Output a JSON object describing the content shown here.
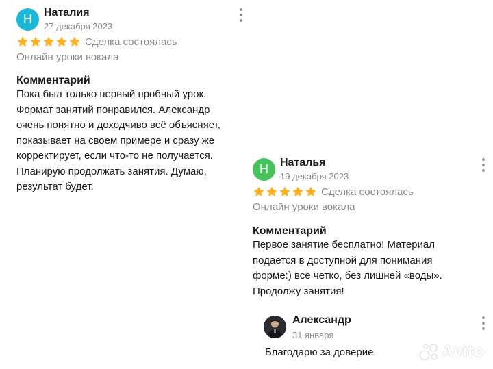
{
  "colors": {
    "star": "#ffb021",
    "avatar_review1": "#1bb8d9",
    "avatar_review2": "#48c25a"
  },
  "reviews": [
    {
      "avatar_letter": "Н",
      "name": "Наталия",
      "date": "27 декабря 2023",
      "rating": 5,
      "deal_status": "Сделка состоялась",
      "service": "Онлайн уроки вокала",
      "comment_title": "Комментарий",
      "comment_lines": [
        "Пока был только первый пробный урок.",
        "Формат занятий понравился. Александр",
        "очень понятно и доходчиво всё объясняет,",
        "показывает на своем примере и сразу же",
        "корректирует, если что-то не получается.",
        "Планирую продолжать занятия. Думаю,",
        "результат будет."
      ]
    },
    {
      "avatar_letter": "Н",
      "name": "Наталья",
      "date": "19 декабря 2023",
      "rating": 5,
      "deal_status": "Сделка состоялась",
      "service": "Онлайн уроки вокала",
      "comment_title": "Комментарий",
      "comment_lines": [
        "Первое занятие бесплатно! Материал",
        "подается в доступной для понимания",
        "форме:) все четко, без лишней «воды».",
        "Продолжу занятия!"
      ]
    }
  ],
  "reply": {
    "name": "Александр",
    "date": "31 января",
    "text": "Благодарю за доверие"
  },
  "watermark": {
    "text": "Avito"
  }
}
